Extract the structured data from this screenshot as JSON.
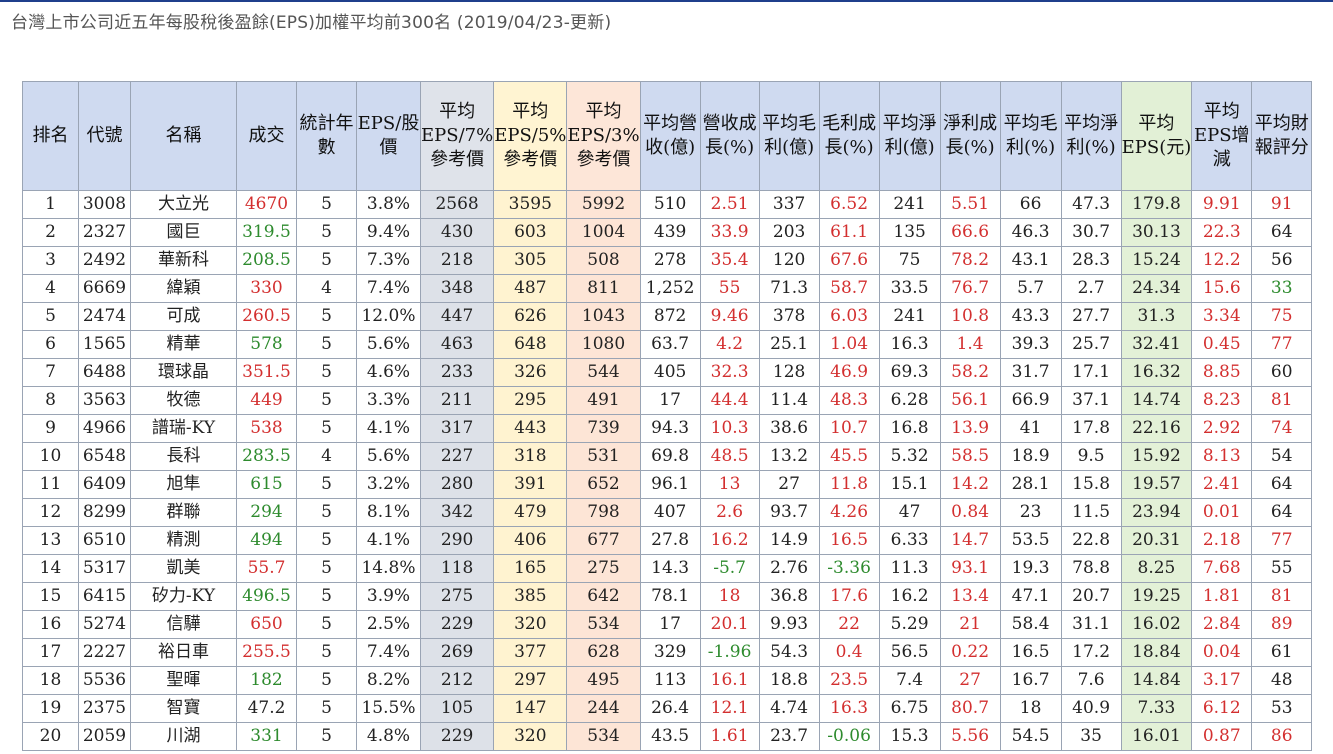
{
  "title": "台灣上市公司近五年每股稅後盈餘(EPS)加權平均前300名 (2019/04/23-更新)",
  "columns": [
    "排名",
    "代號",
    "名稱",
    "成交",
    "統計年數",
    "EPS/股價",
    "平均EPS/7%參考價",
    "平均EPS/5%參考價",
    "平均EPS/3%參考價",
    "平均營收(億)",
    "營收成長(%)",
    "平均毛利(億)",
    "毛利成長(%)",
    "平均淨利(億)",
    "淨利成長(%)",
    "平均毛利(%)",
    "平均淨利(%)",
    "平均EPS(元)",
    "平均EPS增減",
    "平均財報評分"
  ],
  "rows": [
    [
      "1",
      "3008",
      "大立光",
      "4670",
      "5",
      "3.8%",
      "2568",
      "3595",
      "5992",
      "510",
      "2.51",
      "337",
      "6.52",
      "241",
      "5.51",
      "66",
      "47.3",
      "179.8",
      "9.91",
      "91"
    ],
    [
      "2",
      "2327",
      "國巨",
      "319.5",
      "5",
      "9.4%",
      "430",
      "603",
      "1004",
      "439",
      "33.9",
      "203",
      "61.1",
      "135",
      "66.6",
      "46.3",
      "30.7",
      "30.13",
      "22.3",
      "64"
    ],
    [
      "3",
      "2492",
      "華新科",
      "208.5",
      "5",
      "7.3%",
      "218",
      "305",
      "508",
      "278",
      "35.4",
      "120",
      "67.6",
      "75",
      "78.2",
      "43.1",
      "28.3",
      "15.24",
      "12.2",
      "56"
    ],
    [
      "4",
      "6669",
      "緯穎",
      "330",
      "4",
      "7.4%",
      "348",
      "487",
      "811",
      "1,252",
      "55",
      "71.3",
      "58.7",
      "33.5",
      "76.7",
      "5.7",
      "2.7",
      "24.34",
      "15.6",
      "33"
    ],
    [
      "5",
      "2474",
      "可成",
      "260.5",
      "5",
      "12.0%",
      "447",
      "626",
      "1043",
      "872",
      "9.46",
      "378",
      "6.03",
      "241",
      "10.8",
      "43.3",
      "27.7",
      "31.3",
      "3.34",
      "75"
    ],
    [
      "6",
      "1565",
      "精華",
      "578",
      "5",
      "5.6%",
      "463",
      "648",
      "1080",
      "63.7",
      "4.2",
      "25.1",
      "1.04",
      "16.3",
      "1.4",
      "39.3",
      "25.7",
      "32.41",
      "0.45",
      "77"
    ],
    [
      "7",
      "6488",
      "環球晶",
      "351.5",
      "5",
      "4.6%",
      "233",
      "326",
      "544",
      "405",
      "32.3",
      "128",
      "46.9",
      "69.3",
      "58.2",
      "31.7",
      "17.1",
      "16.32",
      "8.85",
      "60"
    ],
    [
      "8",
      "3563",
      "牧德",
      "449",
      "5",
      "3.3%",
      "211",
      "295",
      "491",
      "17",
      "44.4",
      "11.4",
      "48.3",
      "6.28",
      "56.1",
      "66.9",
      "37.1",
      "14.74",
      "8.23",
      "81"
    ],
    [
      "9",
      "4966",
      "譜瑞-KY",
      "538",
      "5",
      "4.1%",
      "317",
      "443",
      "739",
      "94.3",
      "10.3",
      "38.6",
      "10.7",
      "16.8",
      "13.9",
      "41",
      "17.8",
      "22.16",
      "2.92",
      "74"
    ],
    [
      "10",
      "6548",
      "長科",
      "283.5",
      "4",
      "5.6%",
      "227",
      "318",
      "531",
      "69.8",
      "48.5",
      "13.2",
      "45.5",
      "5.32",
      "58.5",
      "18.9",
      "9.5",
      "15.92",
      "8.13",
      "54"
    ],
    [
      "11",
      "6409",
      "旭隼",
      "615",
      "5",
      "3.2%",
      "280",
      "391",
      "652",
      "96.1",
      "13",
      "27",
      "11.8",
      "15.1",
      "14.2",
      "28.1",
      "15.8",
      "19.57",
      "2.41",
      "64"
    ],
    [
      "12",
      "8299",
      "群聯",
      "294",
      "5",
      "8.1%",
      "342",
      "479",
      "798",
      "407",
      "2.6",
      "93.7",
      "4.26",
      "47",
      "0.84",
      "23",
      "11.5",
      "23.94",
      "0.01",
      "64"
    ],
    [
      "13",
      "6510",
      "精測",
      "494",
      "5",
      "4.1%",
      "290",
      "406",
      "677",
      "27.8",
      "16.2",
      "14.9",
      "16.5",
      "6.33",
      "14.7",
      "53.5",
      "22.8",
      "20.31",
      "2.18",
      "77"
    ],
    [
      "14",
      "5317",
      "凱美",
      "55.7",
      "5",
      "14.8%",
      "118",
      "165",
      "275",
      "14.3",
      "-5.7",
      "2.76",
      "-3.36",
      "11.3",
      "93.1",
      "19.3",
      "78.8",
      "8.25",
      "7.68",
      "55"
    ],
    [
      "15",
      "6415",
      "矽力-KY",
      "496.5",
      "5",
      "3.9%",
      "275",
      "385",
      "642",
      "78.1",
      "18",
      "36.8",
      "17.6",
      "16.2",
      "13.4",
      "47.1",
      "20.7",
      "19.25",
      "1.81",
      "81"
    ],
    [
      "16",
      "5274",
      "信驊",
      "650",
      "5",
      "2.5%",
      "229",
      "320",
      "534",
      "17",
      "20.1",
      "9.93",
      "22",
      "5.29",
      "21",
      "58.4",
      "31.1",
      "16.02",
      "2.84",
      "89"
    ],
    [
      "17",
      "2227",
      "裕日車",
      "255.5",
      "5",
      "7.4%",
      "269",
      "377",
      "628",
      "329",
      "-1.96",
      "54.3",
      "0.4",
      "56.5",
      "0.22",
      "16.5",
      "17.2",
      "18.84",
      "0.04",
      "61"
    ],
    [
      "18",
      "5536",
      "聖暉",
      "182",
      "5",
      "8.2%",
      "212",
      "297",
      "495",
      "113",
      "16.1",
      "18.8",
      "23.5",
      "7.4",
      "27",
      "16.7",
      "7.6",
      "14.84",
      "3.17",
      "48"
    ],
    [
      "19",
      "2375",
      "智寶",
      "47.2",
      "5",
      "15.5%",
      "105",
      "147",
      "244",
      "26.4",
      "12.1",
      "4.74",
      "16.3",
      "6.75",
      "80.7",
      "18",
      "40.9",
      "7.33",
      "6.12",
      "53"
    ],
    [
      "20",
      "2059",
      "川湖",
      "331",
      "5",
      "4.8%",
      "229",
      "320",
      "534",
      "43.5",
      "1.61",
      "23.7",
      "-0.06",
      "15.3",
      "5.56",
      "54.5",
      "35",
      "16.01",
      "0.87",
      "86"
    ]
  ],
  "price_colors": [
    "red",
    "green",
    "green",
    "red",
    "red",
    "green",
    "red",
    "red",
    "red",
    "green",
    "green",
    "green",
    "green",
    "red",
    "green",
    "red",
    "red",
    "green",
    "dark",
    "green"
  ],
  "score_colors": [
    "red",
    "dark",
    "dark",
    "green",
    "red",
    "red",
    "dark",
    "red",
    "red",
    "dark",
    "dark",
    "dark",
    "red",
    "dark",
    "red",
    "red",
    "dark",
    "dark",
    "dark",
    "red"
  ],
  "colors": {
    "red": "#d32f2f",
    "green": "#2e8b2e",
    "header_bg": "#cfdaf0",
    "border": "#9aa4b4"
  }
}
